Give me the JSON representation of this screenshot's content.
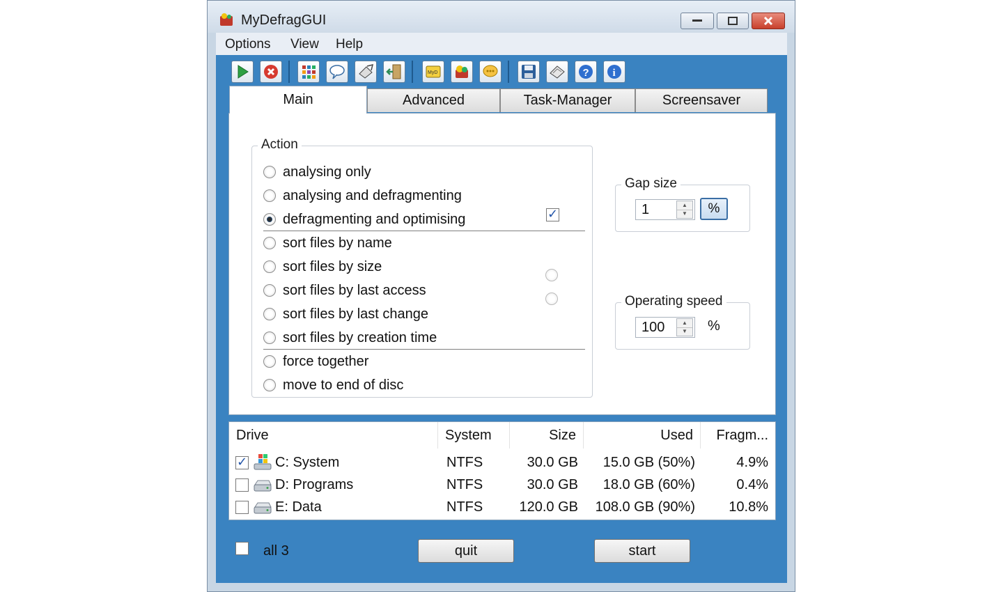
{
  "window": {
    "title": "MyDefragGUI"
  },
  "menu": [
    "Options",
    "View",
    "Help"
  ],
  "toolbar": {
    "groups": [
      [
        "play-icon",
        "stop-icon"
      ],
      [
        "grid-icon",
        "speech-bubble-icon",
        "disk-edit-icon",
        "exit-door-icon"
      ],
      [
        "myd-icon",
        "app-icon",
        "chat-icon"
      ],
      [
        "save-icon",
        "disk-icon",
        "help-icon",
        "info-icon"
      ]
    ]
  },
  "tabs": [
    {
      "label": "Main",
      "active": true
    },
    {
      "label": "Advanced",
      "active": false
    },
    {
      "label": "Task-Manager",
      "active": false
    },
    {
      "label": "Screensaver",
      "active": false
    }
  ],
  "action": {
    "legend": "Action",
    "options": [
      {
        "label": "analysing only",
        "selected": false
      },
      {
        "label": "analysing and defragmenting",
        "selected": false
      },
      {
        "label": "defragmenting and optimising",
        "selected": true
      },
      {
        "label": "sort files by name",
        "selected": false
      },
      {
        "label": "sort files by size",
        "selected": false
      },
      {
        "label": "sort files by last access",
        "selected": false
      },
      {
        "label": "sort files by last change",
        "selected": false
      },
      {
        "label": "sort files by creation time",
        "selected": false
      },
      {
        "label": "force together",
        "selected": false
      },
      {
        "label": "move to end of disc",
        "selected": false
      }
    ],
    "optimise_checkbox_checked": true
  },
  "gap": {
    "legend": "Gap size",
    "value": "1",
    "unit": "%"
  },
  "speed": {
    "legend": "Operating speed",
    "value": "100",
    "unit": "%"
  },
  "drives": {
    "headers": [
      "Drive",
      "System",
      "Size",
      "Used",
      "Fragm..."
    ],
    "rows": [
      {
        "checked": true,
        "icon": "windows-drive-icon",
        "name": "C: System",
        "system": "NTFS",
        "size": "30.0 GB",
        "used": "15.0 GB (50%)",
        "frag": "4.9%"
      },
      {
        "checked": false,
        "icon": "hard-drive-icon",
        "name": "D: Programs",
        "system": "NTFS",
        "size": "30.0 GB",
        "used": "18.0 GB (60%)",
        "frag": "0.4%"
      },
      {
        "checked": false,
        "icon": "hard-drive-icon",
        "name": "E: Data",
        "system": "NTFS",
        "size": "120.0 GB",
        "used": "108.0 GB (90%)",
        "frag": "10.8%"
      }
    ]
  },
  "footer": {
    "all_label": "all 3",
    "all_checked": false,
    "quit_label": "quit",
    "start_label": "start"
  }
}
